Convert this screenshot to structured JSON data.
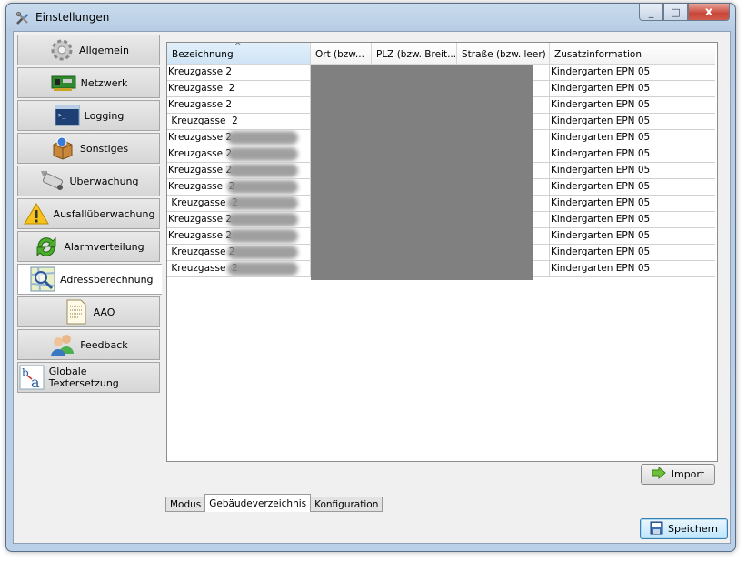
{
  "window": {
    "title": "Einstellungen",
    "buttons": [
      "_",
      "□",
      "x"
    ]
  },
  "nav": {
    "items": [
      {
        "label": "Allgemein",
        "icon": "gear-icon"
      },
      {
        "label": "Netzwerk",
        "icon": "network-card-icon"
      },
      {
        "label": "Logging",
        "icon": "terminal-icon"
      },
      {
        "label": "Sonstiges",
        "icon": "box-icon"
      },
      {
        "label": "Überwachung",
        "icon": "camera-icon"
      },
      {
        "label": "Ausfallüberwachung",
        "icon": "warning-icon"
      },
      {
        "label": "Alarmverteilung",
        "icon": "arrows-cycle-icon"
      },
      {
        "label": "Adressberechnung",
        "icon": "map-search-icon",
        "active": true
      },
      {
        "label": "AAO",
        "icon": "document-icon"
      },
      {
        "label": "Feedback",
        "icon": "users-icon"
      },
      {
        "label": "Globale Textersetzung",
        "icon": "text-replace-icon"
      }
    ]
  },
  "table": {
    "columns": [
      "Bezeichnung",
      "Ort (bzw...",
      "PLZ (bzw. Breit...",
      "Straße (bzw. leer)",
      "Zusatzinformation"
    ],
    "rows": [
      [
        "Kreuzgasse 2",
        "",
        "",
        "",
        "Kindergarten EPN 05"
      ],
      [
        "Kreuzgasse  2",
        "",
        "",
        "",
        "Kindergarten EPN 05"
      ],
      [
        "Kreuzgasse 2",
        "",
        "",
        "",
        "Kindergarten EPN 05"
      ],
      [
        " Kreuzgasse  2",
        "",
        "",
        "",
        "Kindergarten EPN 05"
      ],
      [
        "Kreuzgasse 2",
        "",
        "",
        "",
        "Kindergarten EPN 05"
      ],
      [
        "Kreuzgasse 2",
        "",
        "",
        "",
        "Kindergarten EPN 05"
      ],
      [
        "Kreuzgasse 2",
        "",
        "",
        "",
        "Kindergarten EPN 05"
      ],
      [
        "Kreuzgasse  2",
        "",
        "",
        "",
        "Kindergarten EPN 05"
      ],
      [
        " Kreuzgasse  2",
        "",
        "",
        "",
        "Kindergarten EPN 05"
      ],
      [
        "Kreuzgasse 2",
        "",
        "",
        "",
        "Kindergarten EPN 05"
      ],
      [
        "Kreuzgasse 2",
        "",
        "",
        "",
        "Kindergarten EPN 05"
      ],
      [
        " Kreuzgasse 2",
        "",
        "",
        "",
        "Kindergarten EPN 05"
      ],
      [
        " Kreuzgasse  2",
        "",
        "",
        "",
        "Kindergarten EPN 05"
      ]
    ]
  },
  "import_button": {
    "label": "Import"
  },
  "tabs": [
    {
      "label": "Modus"
    },
    {
      "label": "Gebäudeverzeichnis",
      "active": true
    },
    {
      "label": "Konfiguration"
    }
  ],
  "save_button": {
    "label": "Speichern"
  }
}
